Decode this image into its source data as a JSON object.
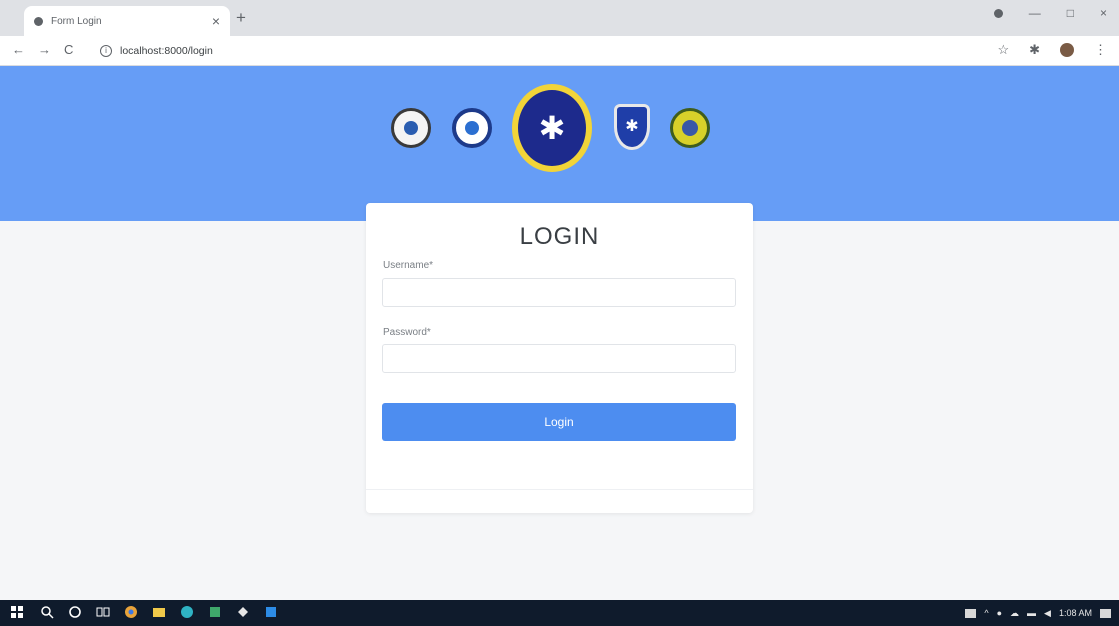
{
  "browser": {
    "tab_title": "Form Login",
    "tab_close": "×",
    "new_tab": "+",
    "url": "localhost:8000/login",
    "info_icon": "i",
    "nav": {
      "back": "←",
      "forward": "→",
      "reload": "C"
    },
    "window_controls": {
      "minimize": "—",
      "maximize": "□",
      "close": "×"
    },
    "toolbar_icons": {
      "star": "☆",
      "extensions": "✱",
      "menu": "⋮"
    }
  },
  "login": {
    "title": "LOGIN",
    "username_label": "Username*",
    "password_label": "Password*",
    "submit_label": "Login"
  },
  "taskbar": {
    "time": "1:08 AM"
  },
  "colors": {
    "banner": "#669df6",
    "button": "#4d8df0",
    "taskbar": "#0f1b2c"
  }
}
